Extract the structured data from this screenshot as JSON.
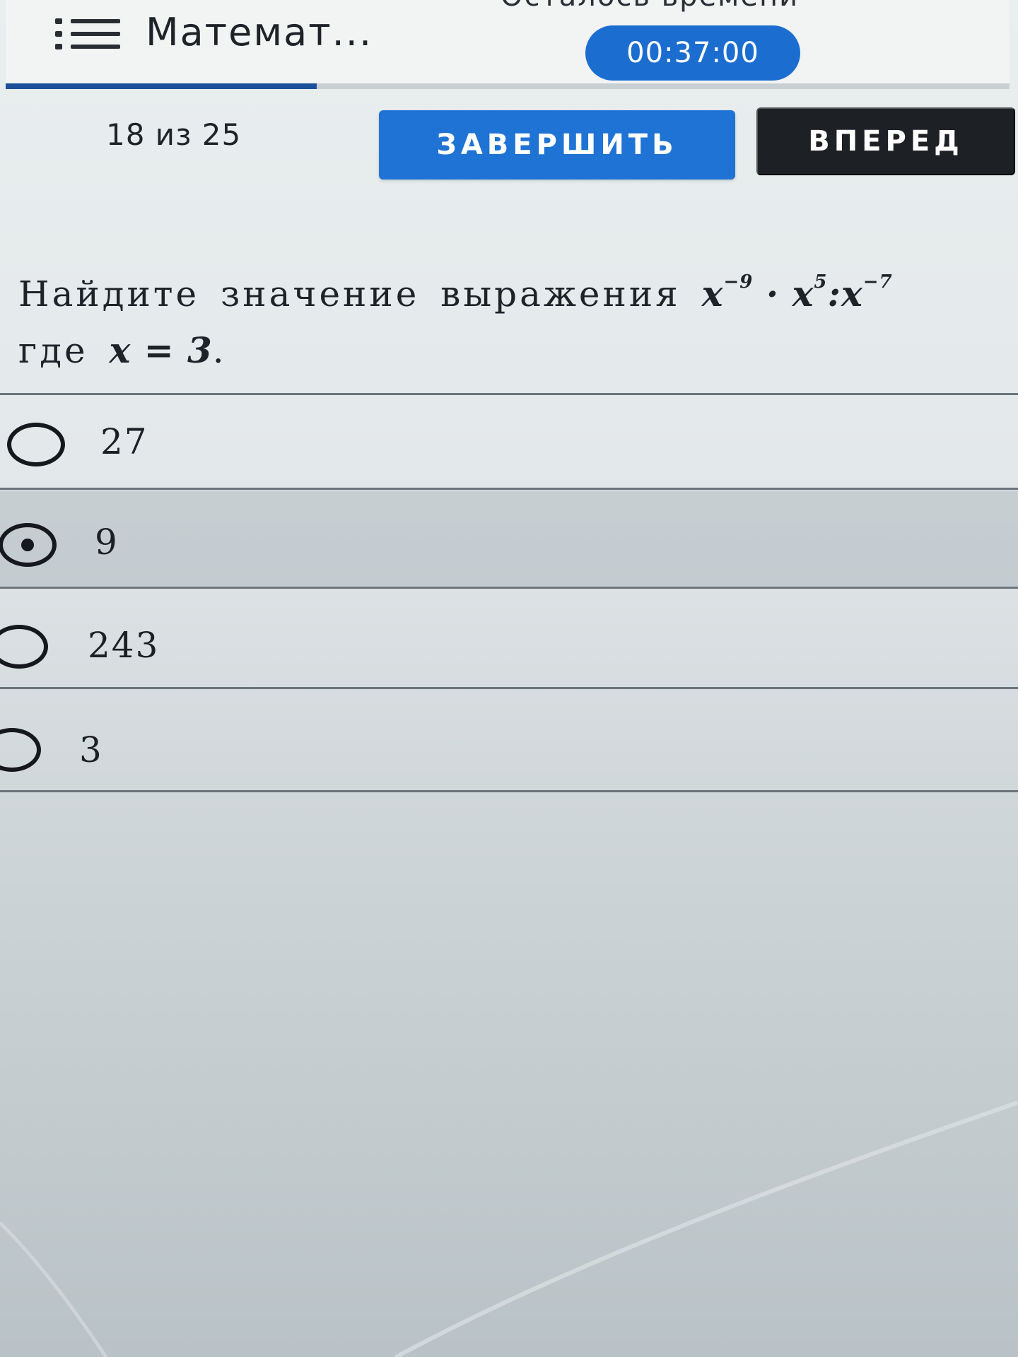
{
  "header": {
    "menu_icon": "list-menu-icon",
    "title": "Математ...",
    "time_left_label": "Осталось времени",
    "timer": "00:37:00",
    "progress_fraction": 0.31
  },
  "toolbar": {
    "counter": "18 из 25",
    "finish_label": "ЗАВЕРШИТЬ",
    "next_label": "ВПЕРЕД"
  },
  "question": {
    "text_prefix": "Найдите значение выражения",
    "expression": {
      "base": "x",
      "exp1": "−9",
      "op1": "·",
      "exp2": "5",
      "op2": ":",
      "exp3": "−7"
    },
    "where_word": "где",
    "condition": "x = 3",
    "end_punct": "."
  },
  "options": [
    {
      "label": "27",
      "selected": false
    },
    {
      "label": "9",
      "selected": true
    },
    {
      "label": "243",
      "selected": false
    },
    {
      "label": "3",
      "selected": false
    }
  ],
  "colors": {
    "accent_blue": "#1f73d4",
    "timer_blue": "#1c6dd0",
    "next_dark": "#1d2025",
    "progress_fill": "#1c4f9b"
  }
}
